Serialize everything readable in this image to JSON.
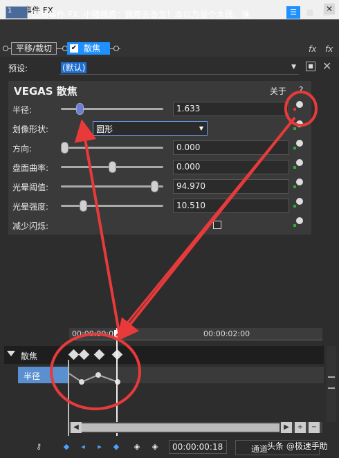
{
  "window": {
    "title": "视频事件 FX",
    "close_label": "✕"
  },
  "header": {
    "icon_label": "1",
    "title": "视频事件 FX: 小猪佩奇：佩奇去香龙！本以为是个木偶，谁",
    "view_buttons": [
      "☰",
      "▦",
      "▤"
    ]
  },
  "chain": {
    "plugins": [
      {
        "label": "平移/裁切"
      },
      {
        "label": "散焦",
        "checked": true
      }
    ],
    "fx_add": "fx",
    "fx_remove": "fx"
  },
  "preset": {
    "label": "预设:",
    "value": "(默认)"
  },
  "panel": {
    "title": "VEGAS 散焦",
    "about": "关于",
    "help": "?",
    "params": [
      {
        "label": "半径:",
        "value": "1.633",
        "slider": 0.16
      },
      {
        "label": "划像形状:",
        "value": "圆形"
      },
      {
        "label": "方向:",
        "value": "0.000",
        "slider": 0.0
      },
      {
        "label": "盘面曲率:",
        "value": "0.000",
        "slider": 0.5
      },
      {
        "label": "光晕阈值:",
        "value": "94.970",
        "slider": 0.95
      },
      {
        "label": "光晕强度:",
        "value": "10.510",
        "slider": 0.2
      },
      {
        "label": "减少闪烁:",
        "checked": false
      }
    ]
  },
  "timeline": {
    "ruler": [
      "00:00:00:00",
      "00:00:02:00"
    ],
    "track": "散焦",
    "sub_track": "半径",
    "timecode": "00:00:00:18",
    "channel": "通道",
    "watermark": "头条 @极速手助"
  },
  "colors": {
    "accent": "#1e90ff",
    "annotation": "#e83a3a"
  }
}
